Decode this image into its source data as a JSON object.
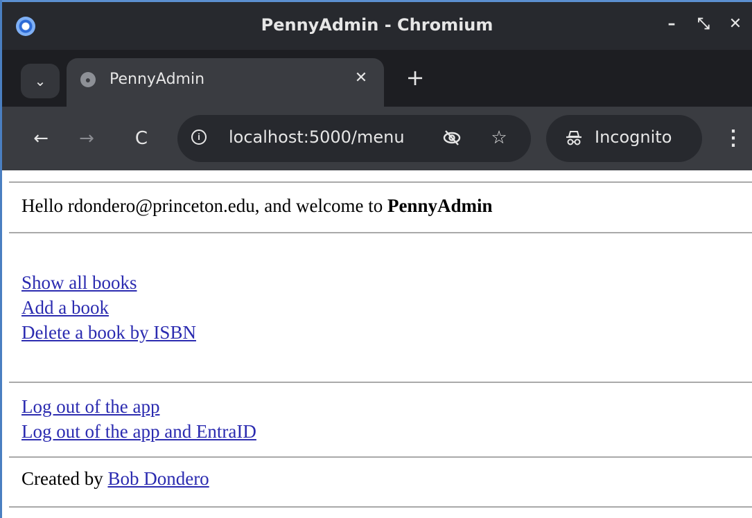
{
  "window": {
    "title": "PennyAdmin - Chromium",
    "controls": {
      "minimize": "–",
      "maximize": "⤡",
      "close": "✕"
    }
  },
  "tabs": [
    {
      "title": "PennyAdmin",
      "close": "✕",
      "active": true
    }
  ],
  "tabstrip": {
    "menu": "⌄",
    "new_tab": "+"
  },
  "toolbar": {
    "back": "←",
    "forward": "→",
    "reload": "C",
    "info": "i",
    "url": "localhost:5000/menu",
    "tracking_icon": "eye-off-icon",
    "star": "☆",
    "incognito_label": "Incognito",
    "menu": "⋮"
  },
  "page": {
    "greeting_prefix": "Hello rdondero@princeton.edu, and welcome to ",
    "app_name": "PennyAdmin",
    "menu_links": [
      "Show all books",
      "Add a book",
      "Delete a book by ISBN"
    ],
    "logout_links": [
      "Log out of the app",
      "Log out of the app and EntraID"
    ],
    "credit_prefix": "Created by ",
    "credit_author": "Bob Dondero"
  },
  "colors": {
    "link": "#2b2bb0",
    "titlebar": "#27292e",
    "toolbar": "#3a3c41",
    "rule": "#a9a9a9"
  }
}
